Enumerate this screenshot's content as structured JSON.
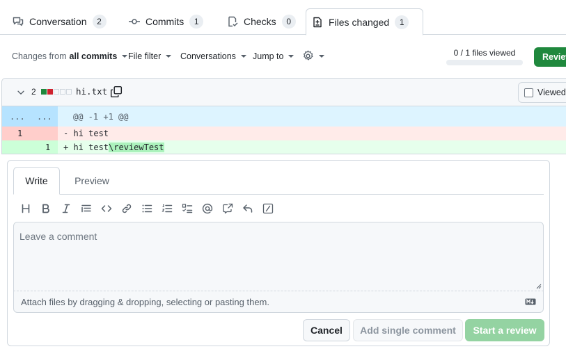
{
  "tabs": [
    {
      "label": "Conversation",
      "count": "2",
      "icon": "comment-discussion-icon"
    },
    {
      "label": "Commits",
      "count": "1",
      "icon": "git-commit-icon"
    },
    {
      "label": "Checks",
      "count": "0",
      "icon": "checklist-icon"
    },
    {
      "label": "Files changed",
      "count": "1",
      "icon": "file-diff-icon",
      "active": true
    }
  ],
  "toolbar": {
    "changes_from_prefix": "Changes from",
    "changes_from_value": "all commits",
    "file_filter": "File filter",
    "conversations": "Conversations",
    "jump_to": "Jump to",
    "settings_icon": "gear-icon",
    "files_viewed": "0 / 1 files viewed",
    "files_viewed_fraction": 0,
    "review_button": "Review changes"
  },
  "file": {
    "changed_lines": "2",
    "diffstat": [
      "add",
      "del",
      "neutral",
      "neutral",
      "neutral"
    ],
    "name": "hi.txt",
    "viewed_label": "Viewed",
    "hunk": {
      "old_marker": "...",
      "new_marker": "...",
      "header": "@@ -1 +1 @@"
    },
    "lines": [
      {
        "type": "del",
        "old": "1",
        "new": "",
        "text": "- hi test"
      },
      {
        "type": "add",
        "old": "",
        "new": "1",
        "text_prefix": "+ hi test",
        "text_highlight": "\\reviewTest"
      }
    ]
  },
  "comment_form": {
    "tab_write": "Write",
    "tab_preview": "Preview",
    "placeholder": "Leave a comment",
    "attach_text": "Attach files by dragging & dropping, selecting or pasting them.",
    "cancel": "Cancel",
    "add_single": "Add single comment",
    "start_review": "Start a review"
  },
  "colors": {
    "accent_green": "#1f883d",
    "delete_red": "#cf222e",
    "hunk_blue": "#ddf4ff"
  }
}
